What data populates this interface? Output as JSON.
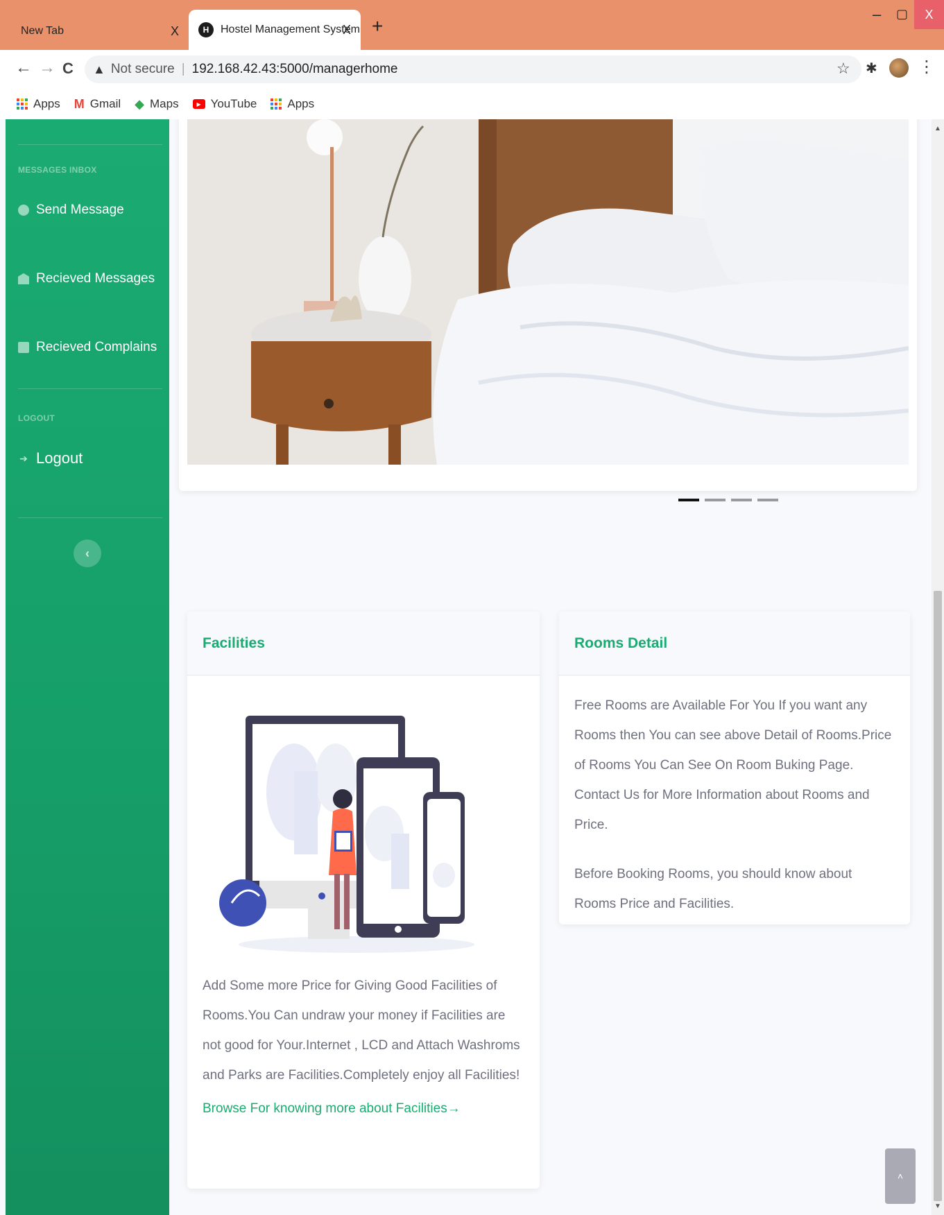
{
  "browser": {
    "tabs": [
      {
        "label": "New Tab",
        "close": "X"
      },
      {
        "label": "Hostel Management System",
        "close": "X"
      }
    ],
    "favicon_letter": "H",
    "new_tab": "+",
    "window": {
      "minimize": "–",
      "maximize": "▢",
      "close": "X"
    },
    "nav": {
      "back": "←",
      "forward": "→",
      "reload": "C"
    },
    "address": {
      "security": "Not secure",
      "url": "192.168.42.43:5000/managerhome"
    },
    "bookmarks": [
      {
        "label": "Apps",
        "icon": "apps-icon"
      },
      {
        "label": "Gmail",
        "icon": "gmail-icon"
      },
      {
        "label": "Maps",
        "icon": "maps-icon"
      },
      {
        "label": "YouTube",
        "icon": "youtube-icon"
      },
      {
        "label": "Apps",
        "icon": "apps-icon"
      }
    ]
  },
  "sidebar": {
    "sections": [
      {
        "heading": "MESSAGES INBOX",
        "items": [
          {
            "label": "Send Message",
            "icon": "chat-icon"
          },
          {
            "label": "Recieved Messages",
            "icon": "envelope-icon"
          },
          {
            "label": "Recieved Complains",
            "icon": "list-icon"
          }
        ]
      },
      {
        "heading": "LOGOUT",
        "items": [
          {
            "label": "Logout",
            "icon": "logout-icon"
          }
        ]
      }
    ],
    "toggle": "‹"
  },
  "carousel": {
    "slides": 4,
    "active": 1
  },
  "facilities": {
    "title": "Facilities",
    "text": "Add Some more Price for Giving Good Facilities of Rooms.You Can undraw your money if Facilities are not good for Your.Internet , LCD and Attach Washroms and Parks are Facilities.Completely enjoy all Facilities!",
    "link": "Browse For knowing more about Facilities→"
  },
  "rooms": {
    "title": "Rooms Detail",
    "paragraphs": [
      "Free Rooms are Available For You If you want any Rooms then You can see above Detail of Rooms.Price of Rooms You Can See On Room Buking Page. Contact Us for More Information about Rooms and Price.",
      "Before Booking Rooms, you should know about Rooms Price and Facilities."
    ]
  },
  "scroll_top": "˄",
  "colors": {
    "brand": "#1aab72",
    "tabbar": "#e8916a"
  }
}
